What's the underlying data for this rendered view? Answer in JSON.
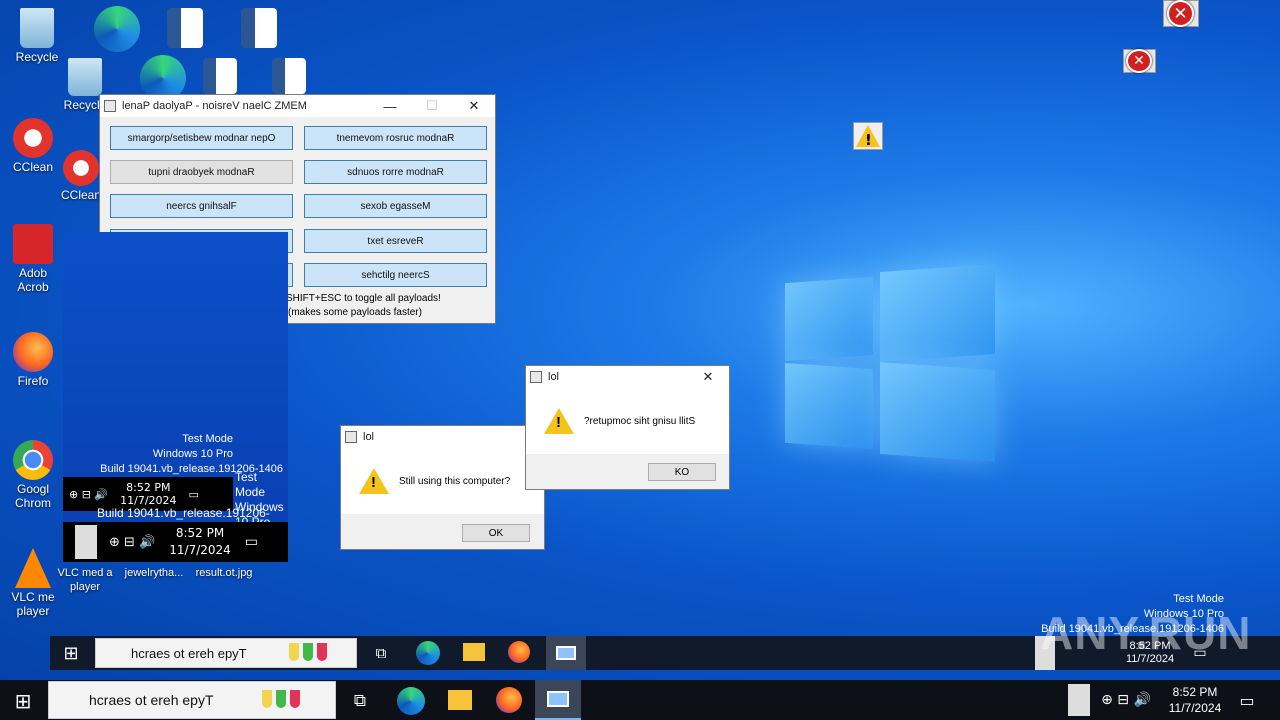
{
  "desktop": {
    "icons": [
      {
        "label": "Recycle",
        "name": "recycle-bin"
      },
      {
        "label": "Recycle",
        "name": "recycle-bin-echo"
      },
      {
        "label": "CClean",
        "name": "ccleaner"
      },
      {
        "label": "CClean",
        "name": "ccleaner-echo"
      },
      {
        "label": "Adob",
        "label2": "Acrob",
        "name": "adobe-acrobat"
      },
      {
        "label": "Firefo",
        "name": "firefox"
      },
      {
        "label": "Googl",
        "label2": "Chrom",
        "name": "google-chrome"
      },
      {
        "label": "VLC me",
        "label2": "player",
        "name": "vlc-player"
      },
      {
        "label": "VLC med a",
        "label2": "player",
        "name": "vlc-player-echo"
      },
      {
        "label": "jewelrytha...",
        "name": "file-jewelry"
      },
      {
        "label": "result.ot.jpg",
        "name": "file-result"
      }
    ],
    "watermark": {
      "line1": "Test Mode",
      "line2": "Windows 10 Pro",
      "line3": "Build 19041.vb_release.191206-1406"
    },
    "watermark_mirror": {
      "line1": "Test Mode",
      "line2": "Windows 10 Pro",
      "line3": "Build 19041.vb_release.191206-1406"
    }
  },
  "memz_panel": {
    "title": "lenaP daolyaP - noisreV naelC ZMEM",
    "buttons": [
      "smargorp/setisbew modnar nepO",
      "tnemevom rosruc modnaR",
      "tupni draobyek modnaR",
      "sdnuos rorre modnaR",
      "neercs gnihsalF",
      "sexob egasseM",
      "",
      "txet esreveR",
      "",
      "sehctilg neercS"
    ],
    "hint1": "SHIFT+ESC to toggle all payloads!",
    "hint2": "(makes some payloads faster)"
  },
  "dialogs": [
    {
      "title": "lol",
      "message": "Still using this computer?",
      "ok": "OK"
    },
    {
      "title": "lol",
      "message": "?retupmoc siht gnisu llitS",
      "ok": "KO"
    }
  ],
  "taskbar": {
    "search_placeholder": "hcraes ot ereh epyT",
    "time": "8:52 PM",
    "date": "11/7/2024"
  },
  "clone": {
    "time": "8:52 PM",
    "date": "11/7/2024",
    "time2": "8:52 PM",
    "date2": "11/7/2024"
  },
  "branding": {
    "text": "ANY.RUN"
  }
}
